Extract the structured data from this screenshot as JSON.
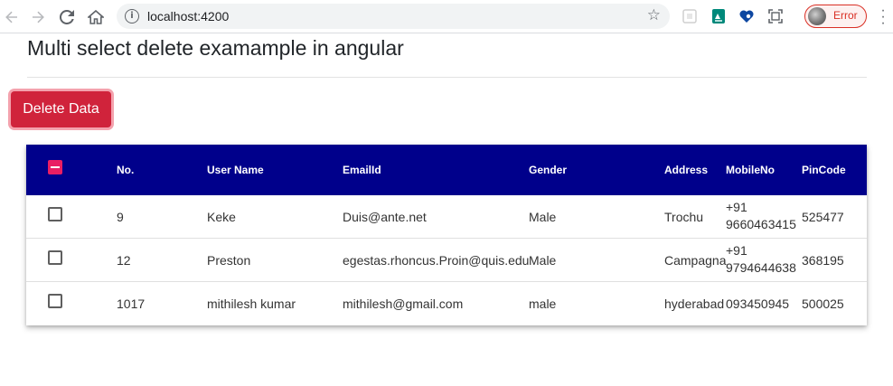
{
  "browser": {
    "url": "localhost:4200",
    "profile_status": "Error",
    "icons": [
      "back-arrow-icon",
      "forward-arrow-icon",
      "reload-icon",
      "home-icon",
      "info-icon",
      "star-icon",
      "extension-icon",
      "extension-icon",
      "extension-icon",
      "screenshot-icon",
      "avatar",
      "menu-dots-icon"
    ]
  },
  "page": {
    "title": "Multi select delete examample in angular",
    "delete_button": "Delete Data"
  },
  "colors": {
    "header_bg": "#00008b",
    "delete_btn": "#d0233b",
    "checkbox_accent": "#e91e63"
  },
  "table": {
    "columns": {
      "no": "No.",
      "username": "User Name",
      "email": "EmailId",
      "gender": "Gender",
      "address": "Address",
      "mobile": "MobileNo",
      "pincode": "PinCode"
    },
    "rows": [
      {
        "no": "9",
        "username": "Keke",
        "email": "Duis@ante.net",
        "gender": "Male",
        "address": "Trochu",
        "mobile_line1": "+91",
        "mobile_line2": "9660463415",
        "pincode": "525477"
      },
      {
        "no": "12",
        "username": "Preston",
        "email": "egestas.rhoncus.Proin@quis.edu",
        "gender": "Male",
        "address": "Campagna",
        "mobile_line1": "+91",
        "mobile_line2": "9794644638",
        "pincode": "368195"
      },
      {
        "no": "1017",
        "username": "mithilesh kumar",
        "email": "mithilesh@gmail.com",
        "gender": "male",
        "address": "hyderabad",
        "mobile": "093450945",
        "pincode": "500025"
      }
    ]
  }
}
